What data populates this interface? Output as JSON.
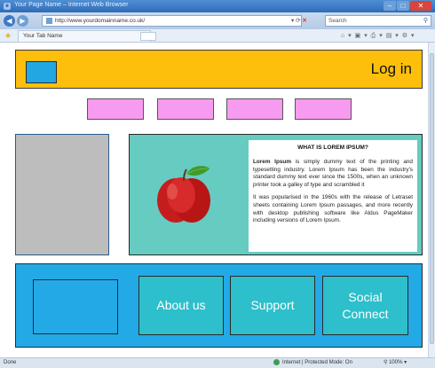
{
  "browser": {
    "window_title": "Your Page Name – Internet Web Browser",
    "url": "http://www.yourdomainname.co.uk/",
    "search_placeholder": "Search",
    "tab_name": "Your Tab Name",
    "status_left": "Done",
    "status_zone": "Internet | Protected Mode: On",
    "zoom": "100%"
  },
  "header": {
    "login_label": "Log in"
  },
  "menu": {
    "items": [
      "",
      "",
      "",
      ""
    ]
  },
  "feature": {
    "heading": "WHAT IS LOREM IPSUM?",
    "lead_bold": "Lorem Ipsum",
    "paragraph1_rest": " is simply dummy text of the printing and typesetting industry. Lorem Ipsum has been the industry's standard dummy text ever since the 1500s, when an unknown printer took a galley of type and scrambled it",
    "paragraph2": "It was popularised in the 1960s with the release of Letraset sheets containing Lorem Ipsum passages, and more recently with desktop publishing software like Aldus PageMaker including versions of Lorem Ipsum."
  },
  "footer": {
    "about_label": "About us",
    "support_label": "Support",
    "social_label_line1": "Social",
    "social_label_line2": "Connect"
  },
  "colors": {
    "header_bg": "#fdbf0c",
    "logo": "#23a7e3",
    "menu_button": "#f79bf0",
    "feature_bg": "#66cbc1",
    "footer_bg": "#23a9e6",
    "footer_button": "#2dbfcb"
  }
}
